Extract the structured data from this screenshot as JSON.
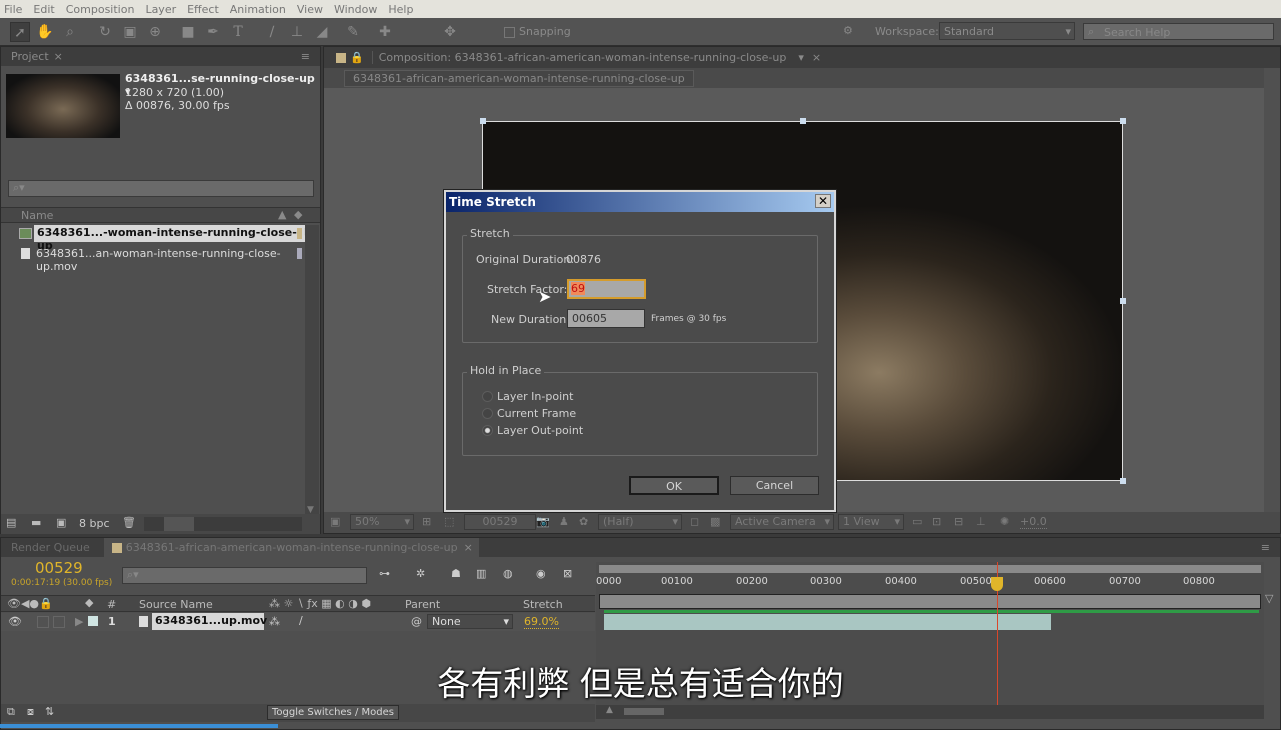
{
  "menu": [
    "File",
    "Edit",
    "Composition",
    "Layer",
    "Effect",
    "Animation",
    "View",
    "Window",
    "Help"
  ],
  "toolbar": {
    "snapping_label": "Snapping",
    "workspace_label": "Workspace:",
    "workspace_value": "Standard",
    "search_placeholder": "Search Help"
  },
  "project": {
    "tab": "Project",
    "item_title": "6348361...se-running-close-up",
    "resolution": "1280 x 720 (1.00)",
    "duration": "Δ 00876, 30.00 fps",
    "col_name": "Name",
    "items": [
      {
        "name": "6348361...-woman-intense-running-close-up",
        "type": "composition"
      },
      {
        "name": "6348361...an-woman-intense-running-close-up.mov",
        "type": "footage"
      }
    ],
    "bpc": "8 bpc"
  },
  "composition": {
    "tab": "Composition: 6348361-african-american-woman-intense-running-close-up",
    "subtab": "6348361-african-american-woman-intense-running-close-up",
    "zoom": "50%",
    "timecode": "00529",
    "resolution": "(Half)",
    "camera": "Active Camera",
    "views": "1 View",
    "exposure": "+0.0"
  },
  "timeline": {
    "render_queue_tab": "Render Queue",
    "comp_tab": "6348361-african-american-woman-intense-running-close-up",
    "current_frame": "00529",
    "timecode_detail": "0:00:17:19 (30.00 fps)",
    "col_source": "Source Name",
    "col_number": "#",
    "col_parent": "Parent",
    "col_stretch": "Stretch",
    "layer": {
      "index": "1",
      "name": "6348361...up.mov",
      "parent": "None",
      "stretch": "69.0%"
    },
    "ruler": [
      "0000",
      "00100",
      "00200",
      "00300",
      "00400",
      "00500",
      "00600",
      "00700",
      "00800"
    ],
    "toggle_label": "Toggle Switches / Modes"
  },
  "dialog": {
    "title": "Time Stretch",
    "stretch_group": "Stretch",
    "original_duration_label": "Original Duration:",
    "original_duration": "00876",
    "stretch_factor_label": "Stretch Factor:",
    "stretch_factor": "69",
    "new_duration_label": "New Duration:",
    "new_duration": "00605",
    "frames_label": "Frames @ 30 fps",
    "hold_group": "Hold in Place",
    "options": [
      "Layer In-point",
      "Current Frame",
      "Layer Out-point"
    ],
    "selected_option": "Layer Out-point",
    "ok": "OK",
    "cancel": "Cancel"
  },
  "subtitle": "各有利弊 但是总有适合你的",
  "colors": {
    "accent_yellow": "#e0b52a",
    "playhead": "#d9472b",
    "layer_bar": "#a9c6c2",
    "work_area": "#2f9b46"
  }
}
